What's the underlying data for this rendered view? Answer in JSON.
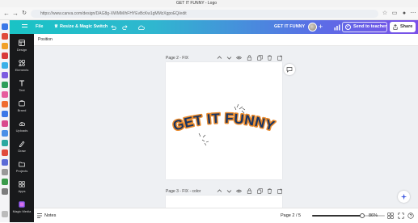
{
  "browser": {
    "tab_title": "GET IT FUNNY - Logo",
    "url": "https://www.canva.com/design/DAG8g-XWMM/hFHYEvBcKw1gMMzXgpoEQ/edit"
  },
  "header": {
    "menu_label": "File",
    "resize_label": "Resize & Magic Switch",
    "design_title": "GET IT FUNNY",
    "send_label": "Send to teacher",
    "share_label": "Share"
  },
  "rail": {
    "items": [
      {
        "label": "Design",
        "icon": "design-icon"
      },
      {
        "label": "Elements",
        "icon": "elements-icon"
      },
      {
        "label": "Text",
        "icon": "text-icon"
      },
      {
        "label": "Brand",
        "icon": "brand-icon"
      },
      {
        "label": "Uploads",
        "icon": "uploads-icon"
      },
      {
        "label": "Draw",
        "icon": "draw-icon"
      },
      {
        "label": "Projects",
        "icon": "projects-icon"
      },
      {
        "label": "Apps",
        "icon": "apps-icon"
      },
      {
        "label": "Magic Media",
        "icon": "magic-media-icon"
      }
    ]
  },
  "toolbar": {
    "position_label": "Position"
  },
  "canvas": {
    "page2_label": "Page 2 - FIX",
    "page3_label": "Page 3 - FIX - color",
    "logo_text": "GET IT FUNNY",
    "logo_fill": "#1b3561",
    "logo_outline": "#e98a2c"
  },
  "footer": {
    "notes_label": "Notes",
    "page_indicator": "Page 2 / 5",
    "zoom_label": "86%",
    "zoom_fraction": 0.86
  }
}
